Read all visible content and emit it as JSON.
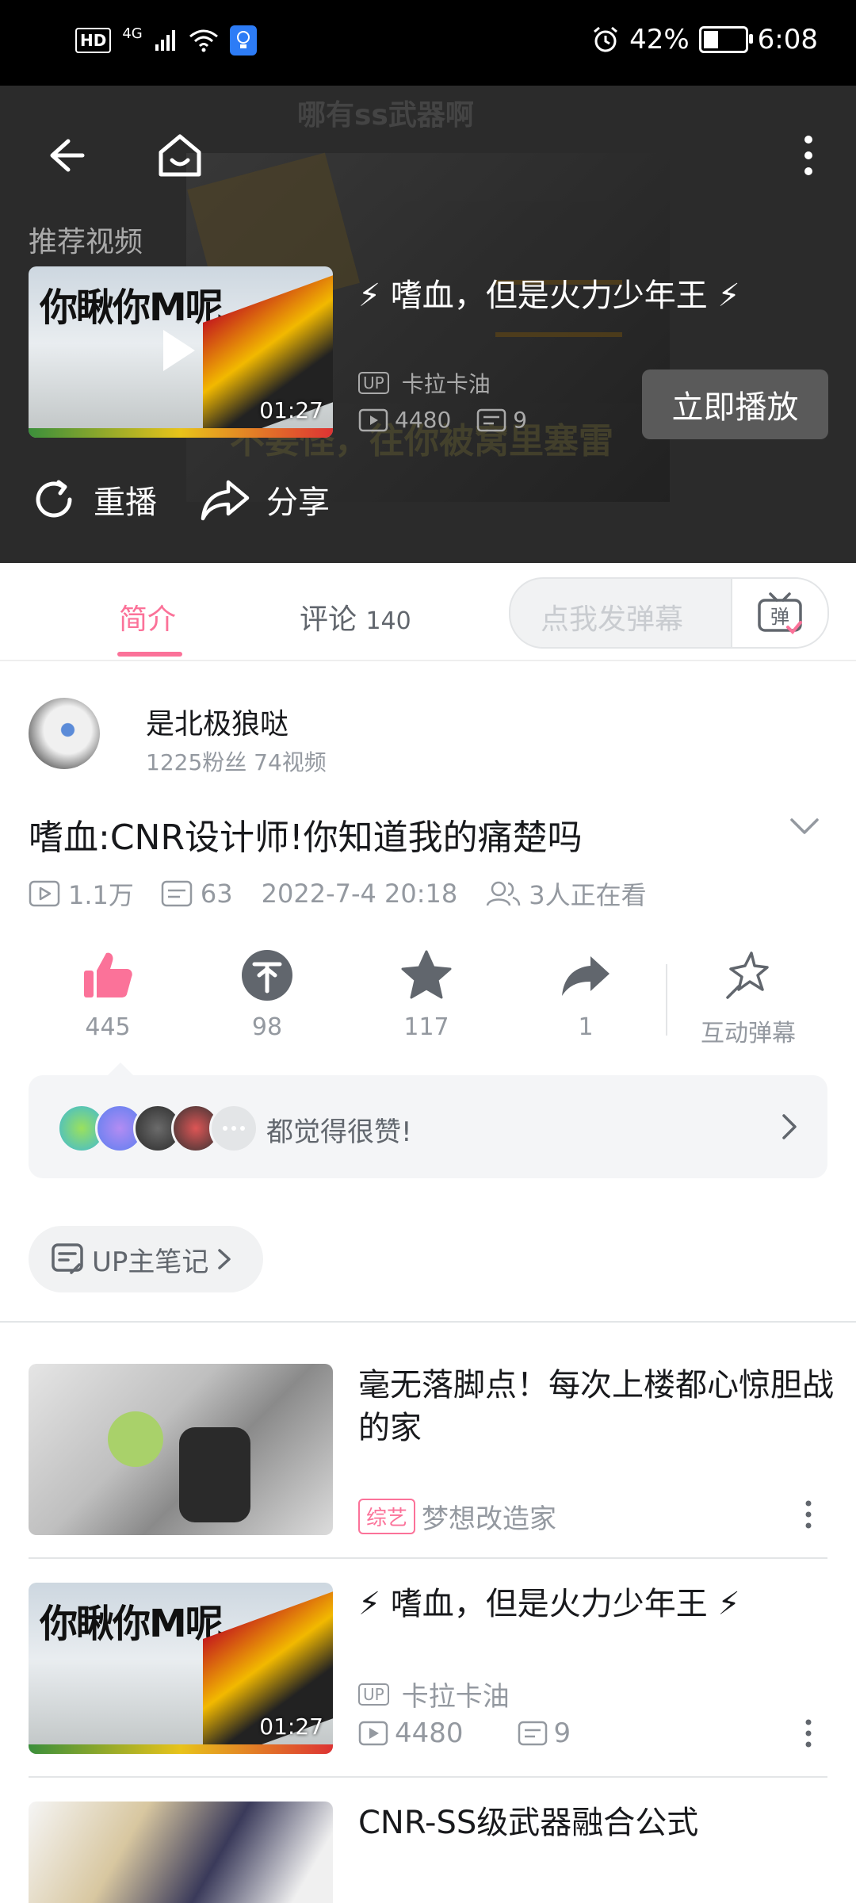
{
  "status_bar": {
    "hd": "HD",
    "network": "4G",
    "battery_pct": "42%",
    "battery_level": 0.42,
    "time": "6:08"
  },
  "player": {
    "bg_title": "哪有ss武器啊",
    "bg_subtitle": "不要怪，往你被窝里塞雷",
    "recommend_label": "推荐视频",
    "rec_video": {
      "thumb_text": "你瞅你M呢",
      "duration": "01:27",
      "title": "⚡ 嗜血，但是火力少年王 ⚡",
      "up_badge": "UP",
      "uploader": "卡拉卡油",
      "views": "4480",
      "danmaku": "9"
    },
    "play_now": "立即播放",
    "replay": "重播",
    "share": "分享"
  },
  "tabs": {
    "intro": "简介",
    "comments_label": "评论",
    "comments_count": "140",
    "danmaku_placeholder": "点我发弹幕",
    "danmaku_btn": "弹"
  },
  "author": {
    "name": "是北极狼哒",
    "stats": "1225粉丝   74视频"
  },
  "video": {
    "title": "嗜血:CNR设计师!你知道我的痛楚吗",
    "views": "1.1万",
    "danmaku": "63",
    "date": "2022-7-4 20:18",
    "watching": "3人正在看"
  },
  "stats": {
    "likes": "445",
    "coins": "98",
    "favorites": "117",
    "shares": "1",
    "interact": "互动弹幕"
  },
  "likes_bar": {
    "text": "都觉得很赞!"
  },
  "notes": {
    "label": "UP主笔记"
  },
  "feed": [
    {
      "title": "毫无落脚点！每次上楼都心惊胆战的家",
      "tag": "综艺",
      "channel": "梦想改造家"
    },
    {
      "thumb_text": "你瞅你M呢",
      "duration": "01:27",
      "title": "⚡ 嗜血，但是火力少年王 ⚡",
      "up_badge": "UP",
      "uploader": "卡拉卡油",
      "views": "4480",
      "danmaku": "9"
    },
    {
      "title": "CNR-SS级武器融合公式"
    }
  ],
  "colors": {
    "accent": "#fb7299",
    "text_secondary": "#9499a0"
  }
}
